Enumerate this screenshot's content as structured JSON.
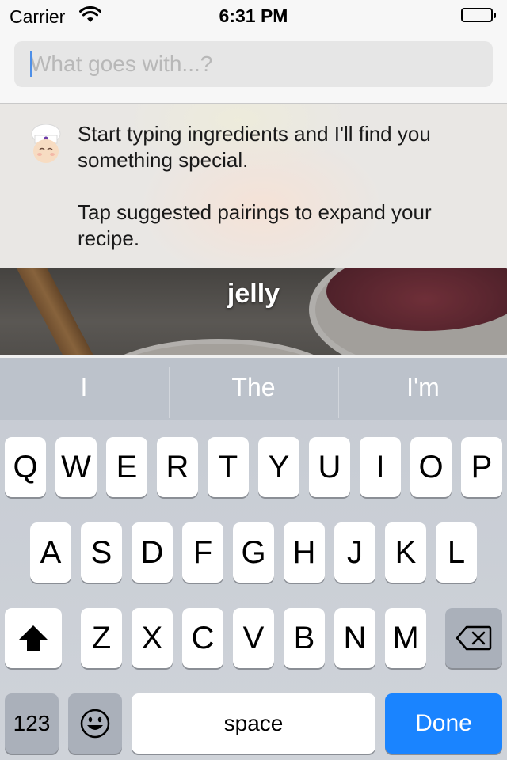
{
  "status_bar": {
    "carrier": "Carrier",
    "time": "6:31 PM",
    "wifi_icon": "wifi-icon",
    "battery_icon": "battery-icon"
  },
  "search": {
    "placeholder": "What goes with...?",
    "value": ""
  },
  "hint": {
    "avatar_icon": "chef-icon",
    "line1": "Start typing ingredients and I'll find you something special.",
    "line2": "Tap suggested pairings to expand your recipe."
  },
  "suggestion": {
    "label": "jelly"
  },
  "keyboard": {
    "predictions": [
      "I",
      "The",
      "I'm"
    ],
    "row1": [
      "Q",
      "W",
      "E",
      "R",
      "T",
      "Y",
      "U",
      "I",
      "O",
      "P"
    ],
    "row2": [
      "A",
      "S",
      "D",
      "F",
      "G",
      "H",
      "J",
      "K",
      "L"
    ],
    "row3": [
      "Z",
      "X",
      "C",
      "V",
      "B",
      "N",
      "M"
    ],
    "shift_icon": "shift-icon",
    "delete_icon": "delete-icon",
    "emoji_icon": "emoji-icon",
    "numbers_label": "123",
    "space_label": "space",
    "done_label": "Done",
    "done_color": "#1a84ff"
  }
}
